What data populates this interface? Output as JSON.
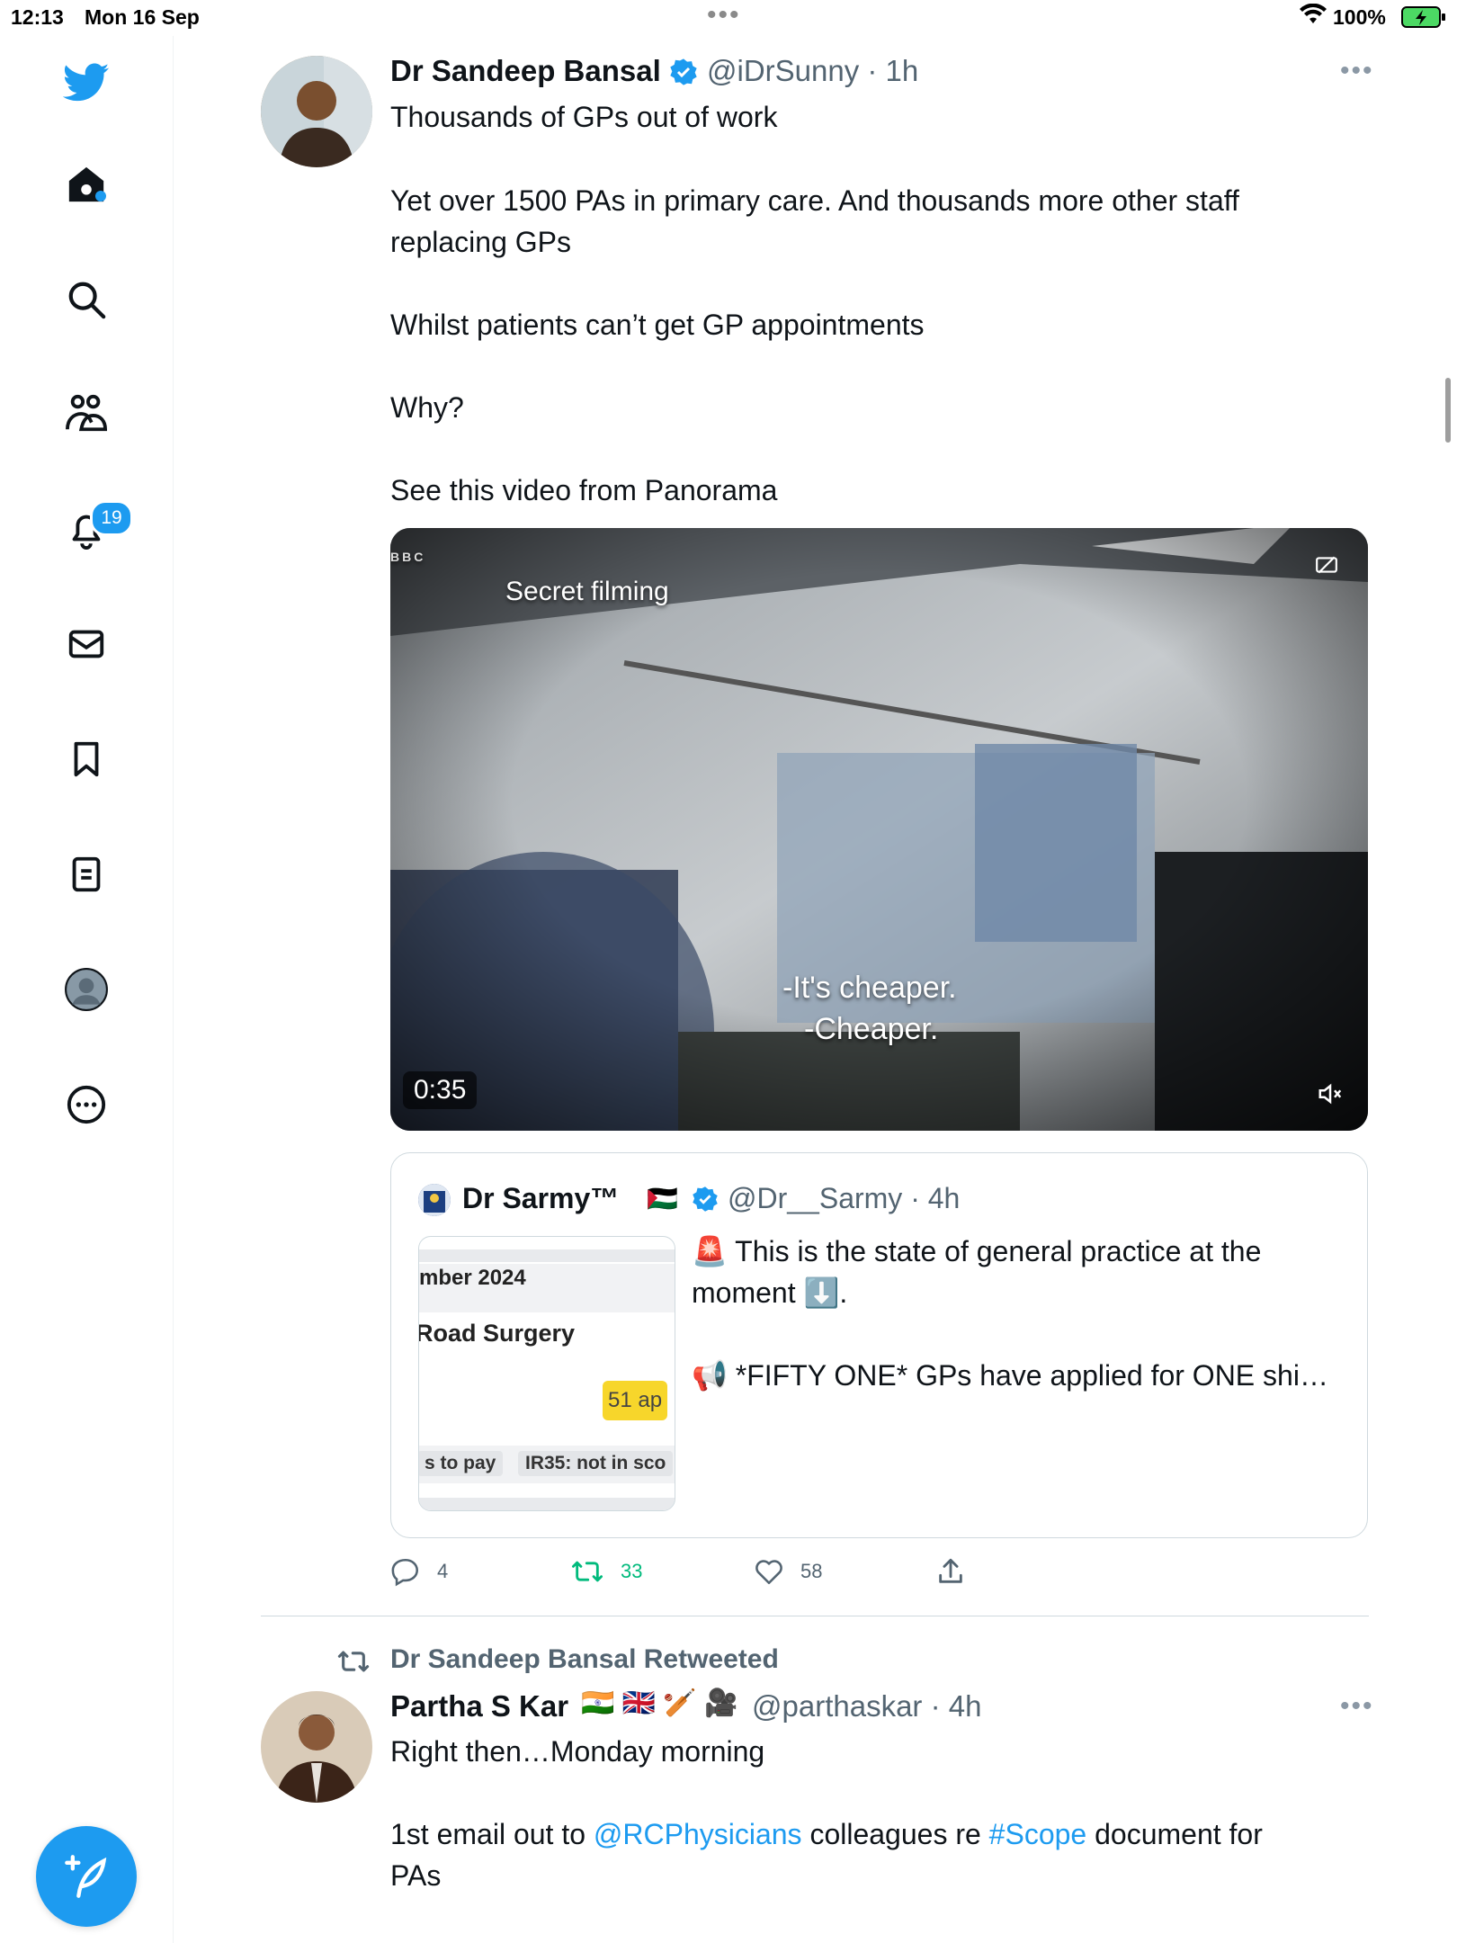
{
  "status_bar": {
    "time": "12:13",
    "date": "Mon 16 Sep",
    "battery": "100%"
  },
  "sidebar": {
    "notifications_badge": "19",
    "items": [
      {
        "name": "twitter-logo-icon"
      },
      {
        "name": "home-icon"
      },
      {
        "name": "search-icon"
      },
      {
        "name": "communities-icon"
      },
      {
        "name": "notifications-icon"
      },
      {
        "name": "messages-icon"
      },
      {
        "name": "bookmarks-icon"
      },
      {
        "name": "lists-icon"
      },
      {
        "name": "profile-icon"
      },
      {
        "name": "more-icon"
      }
    ],
    "accent": "#1d9bf0"
  },
  "tweet1": {
    "name": "Dr Sandeep Bansal",
    "handle_time": "@iDrSunny · 1h",
    "lines": [
      "Thousands of GPs out of work",
      "Yet over 1500 PAs in primary care. And thousands more other staff",
      "replacing GPs",
      "Whilst patients can’t get GP appointments",
      "Why?",
      "See this video from Panorama"
    ],
    "video": {
      "bbc": "BBC",
      "caption_top": "Secret filming",
      "subtitle1": "-It's cheaper.",
      "subtitle2": "-Cheaper.",
      "duration": "0:35"
    },
    "quote": {
      "name": "Dr Sarmy™",
      "flag": "🇵🇸",
      "handle_time": "@Dr__Sarmy · 4h",
      "line1": "🚨 This is the state of general practice at the",
      "line2": "moment ⬇️.",
      "line3": "📢 *FIFTY ONE* GPs have applied for ONE shi…",
      "thumb": {
        "date": "mber 2024",
        "surgery": "Road Surgery",
        "apps": "51 ap",
        "tag1": "s to pay",
        "tag2": "IR35: not in sco"
      }
    },
    "actions": {
      "replies": "4",
      "retweets": "33",
      "likes": "58"
    },
    "retweet_color": "#00ba7c"
  },
  "tweet2": {
    "retweeted_by": "Dr Sandeep Bansal Retweeted",
    "name": "Partha S Kar",
    "emojis": "🇮🇳 🇬🇧 🏏 🎥",
    "handle_time": "@parthaskar · 4h",
    "line1": "Right then…Monday morning",
    "line2_a": "1st email out to ",
    "line2_mention": "@RCPhysicians",
    "line2_b": " colleagues re ",
    "line2_hashtag": "#Scope",
    "line2_c": " document for",
    "line3": "PAs"
  }
}
